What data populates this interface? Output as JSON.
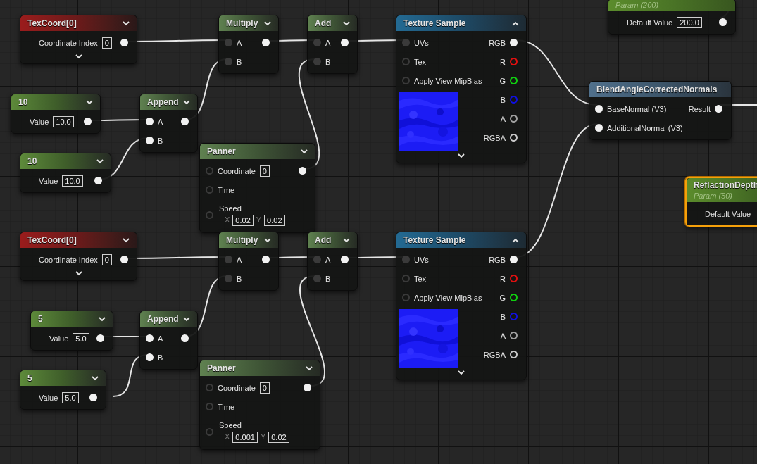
{
  "nodes": [
    {
      "title": "TexCoord[0]",
      "kind": "texcoord",
      "selected": false,
      "expanded": false,
      "inputs": [
        {
          "label": "Coordinate Index",
          "field": "0",
          "kind": "none"
        }
      ],
      "outputs": [
        {
          "kind": "filled"
        }
      ],
      "advanced": true
    },
    {
      "title": "Multiply",
      "kind": "math",
      "selected": false,
      "expanded": false,
      "inputs": [
        {
          "label": "A",
          "kind": "dim"
        },
        {
          "label": "B",
          "kind": "dim"
        }
      ],
      "outputs": [
        {
          "kind": "filled"
        }
      ]
    },
    {
      "title": "Add",
      "kind": "math",
      "selected": false,
      "expanded": false,
      "inputs": [
        {
          "label": "A",
          "kind": "dim"
        },
        {
          "label": "B",
          "kind": "dim"
        }
      ],
      "outputs": [
        {
          "kind": "filled"
        }
      ]
    },
    {
      "title": "Texture Sample",
      "kind": "texture",
      "selected": false,
      "expanded": true,
      "inputs": [
        {
          "label": "UVs",
          "kind": "dim"
        },
        {
          "label": "Tex",
          "kind": "ring"
        },
        {
          "label": "Apply View MipBias",
          "kind": "ring"
        }
      ],
      "outputs": [
        {
          "label": "RGB",
          "kind": "filled"
        },
        {
          "label": "R",
          "kind": "ring",
          "color": "#e01010"
        },
        {
          "label": "G",
          "kind": "ring",
          "color": "#10d010"
        },
        {
          "label": "B",
          "kind": "ring",
          "color": "#1010e0"
        },
        {
          "label": "A",
          "kind": "ring",
          "color": "#a0a0a0"
        },
        {
          "label": "RGBA",
          "kind": "ring",
          "color": "#c8c8c8"
        }
      ],
      "advanced": true
    },
    {
      "subtitle": "Param (200)",
      "kind": "parameter",
      "selected": false,
      "inputs": [
        {
          "label": "Default Value",
          "field": "200.0",
          "kind": "none"
        }
      ],
      "outputs": [
        {
          "kind": "filled"
        }
      ]
    },
    {
      "title": "BlendAngleCorrectedNormals",
      "kind": "function",
      "selected": false,
      "inputs": [
        {
          "label": "BaseNormal (V3)",
          "kind": "filled"
        },
        {
          "label": "AdditionalNormal (V3)",
          "kind": "filled"
        }
      ],
      "outputs": [
        {
          "label": "Result",
          "kind": "filled"
        }
      ]
    },
    {
      "title": "ReflactionDepth",
      "subtitle": "Param (50)",
      "kind": "parameter",
      "selected": true,
      "inputs": [
        {
          "label": "Default Value",
          "kind": "none"
        }
      ]
    },
    {
      "title": "10",
      "kind": "constant",
      "selected": false,
      "expanded": false,
      "inputs": [
        {
          "label": "Value",
          "field": "10.0",
          "kind": "none"
        }
      ],
      "outputs": [
        {
          "kind": "filled"
        }
      ]
    },
    {
      "title": "10",
      "kind": "constant",
      "selected": false,
      "expanded": false,
      "inputs": [
        {
          "label": "Value",
          "field": "10.0",
          "kind": "none"
        }
      ],
      "outputs": [
        {
          "kind": "filled"
        }
      ]
    },
    {
      "title": "Append",
      "kind": "math",
      "selected": false,
      "expanded": false,
      "inputs": [
        {
          "label": "A",
          "kind": "filled"
        },
        {
          "label": "B",
          "kind": "filled"
        }
      ],
      "outputs": [
        {
          "kind": "filled"
        }
      ]
    },
    {
      "title": "Panner",
      "kind": "math",
      "selected": false,
      "expanded": false,
      "inputs": [
        {
          "label": "Coordinate",
          "kind": "ring",
          "field": "0"
        },
        {
          "label": "Time",
          "kind": "ring"
        },
        {
          "label": "Speed",
          "kind": "ring",
          "fields": [
            {
              "axis": "X",
              "value": "0.02"
            },
            {
              "axis": "Y",
              "value": "0.02"
            }
          ]
        }
      ],
      "outputs": [
        {
          "kind": "filled"
        }
      ]
    },
    {
      "title": "TexCoord[0]",
      "kind": "texcoord",
      "selected": false,
      "expanded": false,
      "inputs": [
        {
          "label": "Coordinate Index",
          "field": "0",
          "kind": "none"
        }
      ],
      "outputs": [
        {
          "kind": "filled"
        }
      ],
      "advanced": true
    },
    {
      "title": "Multiply",
      "kind": "math",
      "selected": false,
      "expanded": false,
      "inputs": [
        {
          "label": "A",
          "kind": "dim"
        },
        {
          "label": "B",
          "kind": "dim"
        }
      ],
      "outputs": [
        {
          "kind": "filled"
        }
      ]
    },
    {
      "title": "Add",
      "kind": "math",
      "selected": false,
      "expanded": false,
      "inputs": [
        {
          "label": "A",
          "kind": "dim"
        },
        {
          "label": "B",
          "kind": "dim"
        }
      ],
      "outputs": [
        {
          "kind": "filled"
        }
      ]
    },
    {
      "title": "Texture Sample",
      "kind": "texture",
      "selected": false,
      "expanded": true,
      "inputs": [
        {
          "label": "UVs",
          "kind": "dim"
        },
        {
          "label": "Tex",
          "kind": "ring"
        },
        {
          "label": "Apply View MipBias",
          "kind": "ring"
        }
      ],
      "outputs": [
        {
          "label": "RGB",
          "kind": "filled"
        },
        {
          "label": "R",
          "kind": "ring",
          "color": "#e01010"
        },
        {
          "label": "G",
          "kind": "ring",
          "color": "#10d010"
        },
        {
          "label": "B",
          "kind": "ring",
          "color": "#1010e0"
        },
        {
          "label": "A",
          "kind": "ring",
          "color": "#a0a0a0"
        },
        {
          "label": "RGBA",
          "kind": "ring",
          "color": "#c8c8c8"
        }
      ],
      "advanced": true
    },
    {
      "title": "5",
      "kind": "constant",
      "selected": false,
      "expanded": false,
      "inputs": [
        {
          "label": "Value",
          "field": "5.0",
          "kind": "none"
        }
      ],
      "outputs": [
        {
          "kind": "filled"
        }
      ]
    },
    {
      "title": "5",
      "kind": "constant",
      "selected": false,
      "expanded": false,
      "inputs": [
        {
          "label": "Value",
          "field": "5.0",
          "kind": "none"
        }
      ],
      "outputs": [
        {
          "kind": "filled"
        }
      ]
    },
    {
      "title": "Append",
      "kind": "math",
      "selected": false,
      "expanded": false,
      "inputs": [
        {
          "label": "A",
          "kind": "filled"
        },
        {
          "label": "B",
          "kind": "filled"
        }
      ],
      "outputs": [
        {
          "kind": "filled"
        }
      ]
    },
    {
      "title": "Panner",
      "kind": "math",
      "selected": false,
      "expanded": false,
      "inputs": [
        {
          "label": "Coordinate",
          "kind": "ring",
          "field": "0"
        },
        {
          "label": "Time",
          "kind": "ring"
        },
        {
          "label": "Speed",
          "kind": "ring",
          "fields": [
            {
              "axis": "X",
              "value": "0.001"
            },
            {
              "axis": "Y",
              "value": "0.02"
            }
          ]
        }
      ],
      "outputs": [
        {
          "kind": "filled"
        }
      ]
    }
  ]
}
